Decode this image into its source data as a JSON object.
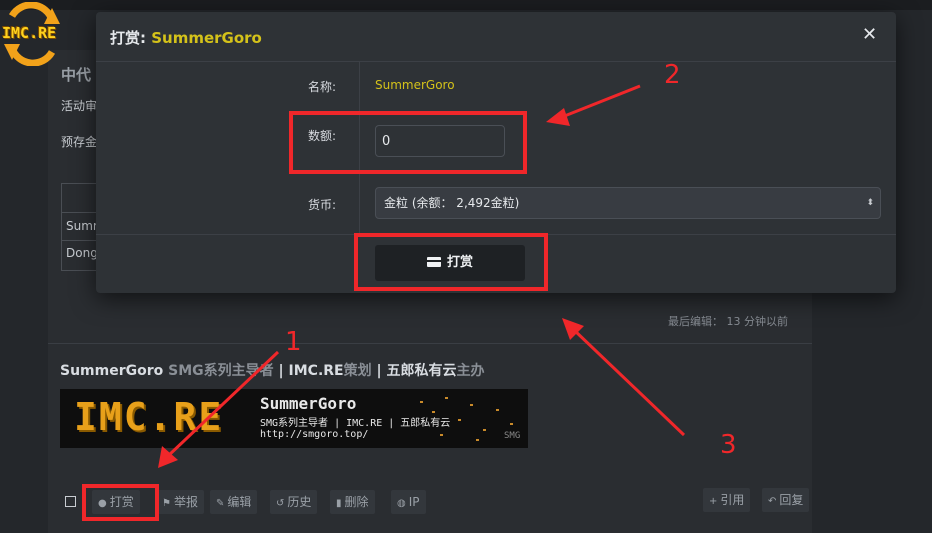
{
  "background": {
    "logo_text": "IMC.RE",
    "fragments": {
      "heading": "中代",
      "line1": "活动审",
      "line2": "预存金",
      "row1": "Summ",
      "row2": "Dong"
    },
    "last_edit": "最后编辑： 13 分钟以前",
    "signature": {
      "name": "SummerGoro",
      "role1": "SMG系列主导者",
      "sep1": "|",
      "site": "IMC.RE",
      "role2": "策划",
      "sep2": "|",
      "org": "五郎私有云",
      "role3": "主办"
    },
    "banner": {
      "big": "IMC.RE",
      "name": "SummerGoro",
      "sub": "SMG系列主导者 | IMC.RE | 五郎私有云",
      "url": "http://smgoro.top/",
      "badge": "SMG"
    },
    "actions": [
      {
        "name": "tip-action-button",
        "icon": "coin-icon",
        "glyph": "●",
        "label": "打赏"
      },
      {
        "name": "report-action-button",
        "icon": "flag-icon",
        "glyph": "⚑",
        "label": "举报"
      },
      {
        "name": "edit-action-button",
        "icon": "pencil-icon",
        "glyph": "✎",
        "label": "编辑"
      },
      {
        "name": "history-action-button",
        "icon": "history-icon",
        "glyph": "↺",
        "label": "历史"
      },
      {
        "name": "delete-action-button",
        "icon": "trash-icon",
        "glyph": "▮",
        "label": "删除"
      },
      {
        "name": "ip-action-button",
        "icon": "globe-icon",
        "glyph": "◍",
        "label": "IP"
      },
      {
        "name": "quote-action-button",
        "icon": "plus-icon",
        "glyph": "+",
        "label": "引用"
      },
      {
        "name": "reply-action-button",
        "icon": "reply-icon",
        "glyph": "↶",
        "label": "回复"
      }
    ]
  },
  "modal": {
    "title_prefix": "打赏:",
    "title_user": "SummerGoro",
    "close_glyph": "✕",
    "name_label": "名称:",
    "name_value": "SummerGoro",
    "amount_label": "数额:",
    "amount_value": "0",
    "currency_label": "货币:",
    "currency_selected": "金粒 (余额： 2,492金粒)",
    "currency_caret": "⬍",
    "submit_label": "打赏"
  },
  "annotations": {
    "n1": "1",
    "n2": "2",
    "n3": "3"
  },
  "colors": {
    "accent_yellow": "#d4c21a",
    "annotation_red": "#f0272a",
    "modal_bg": "#2e3236",
    "page_bg": "#24272b"
  }
}
